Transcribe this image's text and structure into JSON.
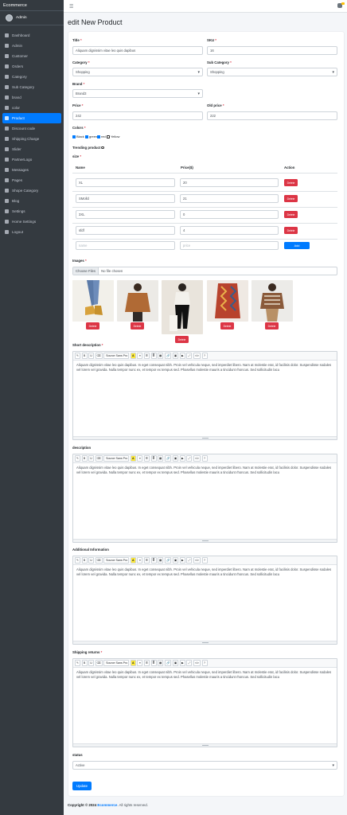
{
  "sidebar": {
    "brand": "Ecommerce",
    "user": "Admin",
    "items": [
      {
        "label": "Dashboard",
        "icon": "dashboard-icon"
      },
      {
        "label": "Admin",
        "icon": "user-icon"
      },
      {
        "label": "Customer",
        "icon": "users-icon"
      },
      {
        "label": "Orders",
        "icon": "cart-icon"
      },
      {
        "label": "Category",
        "icon": "folder-icon"
      },
      {
        "label": "Sub Category",
        "icon": "folder-icon"
      },
      {
        "label": "brand",
        "icon": "tag-icon"
      },
      {
        "label": "color",
        "icon": "palette-icon"
      },
      {
        "label": "Product",
        "icon": "box-icon",
        "active": true
      },
      {
        "label": "Discount code",
        "icon": "percent-icon"
      },
      {
        "label": "Shipping Charge",
        "icon": "truck-icon"
      },
      {
        "label": "Slider",
        "icon": "image-icon"
      },
      {
        "label": "PartnerLogo",
        "icon": "handshake-icon"
      },
      {
        "label": "Messages",
        "icon": "message-icon"
      },
      {
        "label": "Pages",
        "icon": "file-icon"
      },
      {
        "label": "Shope Category",
        "icon": "store-icon"
      },
      {
        "label": "Blog",
        "icon": "blog-icon"
      },
      {
        "label": "Settings",
        "icon": "gear-icon"
      },
      {
        "label": "Home Settings",
        "icon": "home-icon"
      },
      {
        "label": "Logout",
        "icon": "logout-icon"
      }
    ]
  },
  "page": {
    "title": "edit New Product"
  },
  "form": {
    "title_label": "Title",
    "title_value": "Aliquam dignissim vitae leo quis dapibus",
    "sku_label": "SKU",
    "sku_value": "16",
    "category_label": "Category",
    "category_value": "Shopping",
    "subcategory_label": "Sub Category",
    "subcategory_value": "Shopping",
    "brand_label": "Brand",
    "brand_value": "Brand3",
    "price_label": "Price",
    "price_value": "242",
    "oldprice_label": "Old price",
    "oldprice_value": "222",
    "colors_label": "Colors",
    "colors": [
      {
        "name": "Black",
        "checked": true
      },
      {
        "name": "green",
        "checked": true
      },
      {
        "name": "red",
        "checked": true
      },
      {
        "name": "Yellow",
        "checked": false
      }
    ],
    "trending_label": "Trending product",
    "size_label": "size",
    "size_headers": {
      "name": "Name",
      "price": "Price($)",
      "action": "Action"
    },
    "sizes": [
      {
        "name": "XL",
        "price": "20"
      },
      {
        "name": "SMolld",
        "price": "21"
      },
      {
        "name": "3XL",
        "price": "0"
      },
      {
        "name": "sfdf",
        "price": "4"
      }
    ],
    "new_size": {
      "name_placeholder": "name",
      "price_placeholder": "price"
    },
    "delete_label": "Delete",
    "add_label": "Add",
    "images_label": "Images",
    "file_button": "Choose Files",
    "file_status": "No file chosen",
    "editors": [
      {
        "label": "Short description",
        "required": true
      },
      {
        "label": "description",
        "required": false
      },
      {
        "label": "Additional Information",
        "required": false
      },
      {
        "label": "Shipping returns",
        "required": true
      }
    ],
    "editor_text": "Aliquam dignissim vitae leo quis dapibus. In eget consequat nibh. Proin vel vehicula neque, sed imperdiet libero. Nam at molestie erat, id facilisis dolor. Suspendisse sodales vel lorem vel gravida. Nulla tempor nunc ex, et tempor ex tempus sed. Phasellus molestie mauris a tincidunt rhoncus. Sed sollicitudin lacu",
    "editor_font": "Source Sans Pro",
    "status_label": "status",
    "status_value": "Active",
    "update_label": "Update"
  },
  "footer": {
    "prefix": "Copyright © 2024 ",
    "brand": "Ecommerce",
    "suffix": ". All rights reserved."
  }
}
